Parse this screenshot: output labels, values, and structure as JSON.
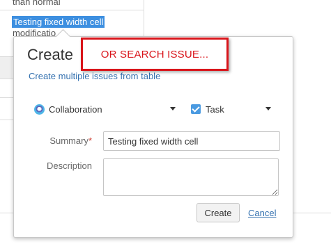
{
  "background": {
    "row_text_top": "than normal",
    "selected_text": "Testing fixed width cell",
    "row_text_below": "modificatio"
  },
  "dialog": {
    "title": "Create",
    "link": "Create multiple issues from table",
    "project": {
      "label": "Collaboration",
      "icon": "project-avatar-icon"
    },
    "issue_type": {
      "label": "Task",
      "icon": "task-checkbox-icon",
      "color": "#4a9ae1"
    },
    "summary": {
      "label": "Summary",
      "required_marker": "*",
      "value": "Testing fixed width cell"
    },
    "description": {
      "label": "Description",
      "value": ""
    },
    "create_label": "Create",
    "cancel_label": "Cancel"
  },
  "callout": {
    "text": "OR SEARCH ISSUE...",
    "color": "#d9141a"
  },
  "colors": {
    "link": "#3572b0",
    "selection": "#3d8fe0"
  }
}
